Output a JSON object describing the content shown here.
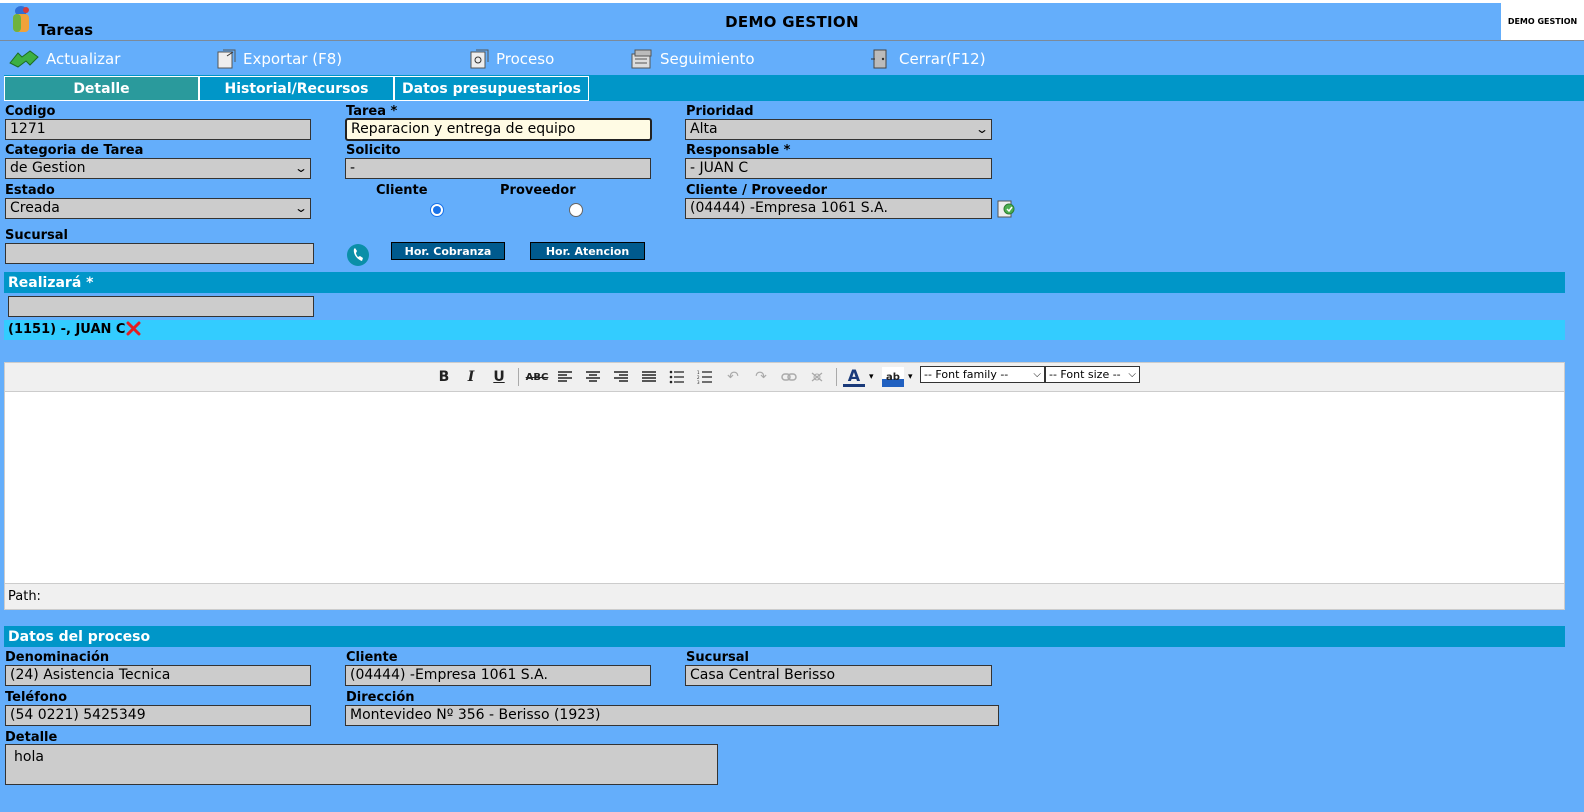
{
  "window": {
    "title": "Tareas",
    "brand": "DEMO GESTION",
    "logo_text": "DEMO GESTION"
  },
  "toolbar": {
    "actualizar": "Actualizar",
    "exportar": "Exportar (F8)",
    "proceso": "Proceso",
    "seguimiento": "Seguimiento",
    "cerrar": "Cerrar(F12)"
  },
  "tabs": [
    {
      "label": "Detalle",
      "active": true
    },
    {
      "label": "Historial/Recursos",
      "active": false
    },
    {
      "label": "Datos presupuestarios",
      "active": false
    }
  ],
  "form": {
    "codigo": {
      "label": "Codigo",
      "value": "1271"
    },
    "tarea": {
      "label": "Tarea *",
      "value": "Reparacion y entrega de equipo"
    },
    "prioridad": {
      "label": "Prioridad",
      "value": "Alta"
    },
    "categoria": {
      "label": "Categoria de Tarea",
      "value": "de Gestion"
    },
    "solicito": {
      "label": "Solicito",
      "value": "-"
    },
    "responsable": {
      "label": "Responsable *",
      "value": "- JUAN C"
    },
    "estado": {
      "label": "Estado",
      "value": "Creada"
    },
    "radio_cliente": "Cliente",
    "radio_proveedor": "Proveedor",
    "cliente_proveedor": {
      "label": "Cliente / Proveedor",
      "value": "(04444) -Empresa 1061 S.A."
    },
    "sucursal": {
      "label": "Sucursal",
      "value": ""
    },
    "hor_cobranza": "Hor. Cobranza",
    "hor_atencion": "Hor. Atencion"
  },
  "realizara": {
    "title": "Realizará *",
    "input_value": "",
    "assignee": "(1151) -, JUAN C"
  },
  "editor": {
    "font_family": "-- Font family --",
    "font_size": "-- Font size --",
    "path_label": "Path:"
  },
  "proceso": {
    "title": "Datos del proceso",
    "denominacion": {
      "label": "Denominación",
      "value": "(24) Asistencia Tecnica"
    },
    "cliente": {
      "label": "Cliente",
      "value": "(04444) -Empresa 1061 S.A."
    },
    "sucursal": {
      "label": "Sucursal",
      "value": "Casa Central Berisso"
    },
    "telefono": {
      "label": "Teléfono",
      "value": "(54 0221) 5425349"
    },
    "direccion": {
      "label": "Dirección",
      "value": "Montevideo Nº 356 - Berisso (1923)"
    },
    "detalle": {
      "label": "Detalle",
      "value": "hola"
    }
  },
  "colors": {
    "background": "#64aefb",
    "bar": "#0096c8",
    "active_tab": "#2a9a9c",
    "chip_row": "#33ccff"
  }
}
